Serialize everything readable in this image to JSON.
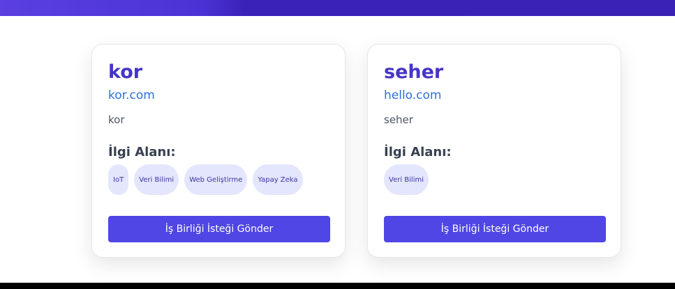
{
  "colors": {
    "banner": "#3b22b6",
    "accent": "#4f46e5",
    "name": "#4535c7",
    "link": "#2f6fd8",
    "tag_bg": "#e3e6fc",
    "tag_text": "#3b33a8"
  },
  "cards": [
    {
      "name": "kor",
      "website": "kor.com",
      "description": "kor",
      "interest_label": "İlgi Alanı:",
      "tags": [
        "IoT",
        "Veri Bilimi",
        "Web Geliştirme",
        "Yapay Zeka"
      ],
      "button_label": "İş Birliği İsteği Gönder"
    },
    {
      "name": "seher",
      "website": "hello.com",
      "description": "seher",
      "interest_label": "İlgi Alanı:",
      "tags": [
        "Veri Bilimi"
      ],
      "button_label": "İş Birliği İsteği Gönder"
    }
  ]
}
